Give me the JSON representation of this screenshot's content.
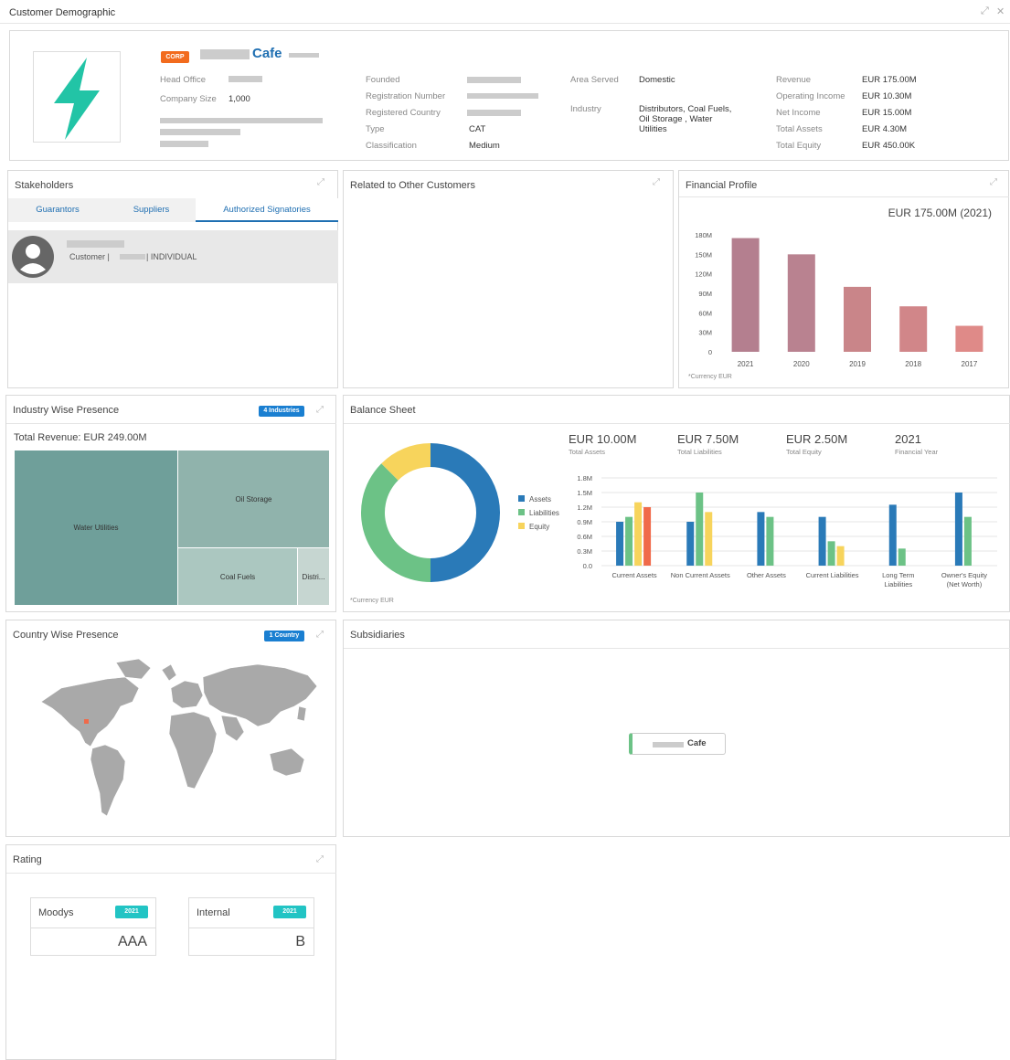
{
  "window": {
    "title": "Customer Demographic"
  },
  "profile": {
    "corp_badge": "CORP",
    "name_suffix": "Cafe",
    "head_office_label": "Head Office",
    "company_size_label": "Company Size",
    "company_size_value": "1,000",
    "founded_label": "Founded",
    "registration_label": "Registration Number",
    "registered_country_label": "Registered Country",
    "type_label": "Type",
    "type_value": "CAT",
    "classification_label": "Classification",
    "classification_value": "Medium",
    "area_served_label": "Area Served",
    "area_served_value": "Domestic",
    "industry_label": "Industry",
    "industry_value": "Distributors, Coal Fuels, Oil Storage , Water Utilities",
    "revenue_label": "Revenue",
    "revenue_value": "EUR 175.00M",
    "operating_income_label": "Operating Income",
    "operating_income_value": "EUR 10.30M",
    "net_income_label": "Net Income",
    "net_income_value": "EUR 15.00M",
    "total_assets_label": "Total Assets",
    "total_assets_value": "EUR 4.30M",
    "total_equity_label": "Total Equity",
    "total_equity_value": "EUR 450.00K",
    "logo_color": "#22c4a6"
  },
  "stakeholders": {
    "title": "Stakeholders",
    "tabs": [
      "Guarantors",
      "Suppliers",
      "Authorized Signatories"
    ],
    "active_tab": 2,
    "item": {
      "role_prefix": "Customer |",
      "role_suffix": "| INDIVIDUAL"
    }
  },
  "related": {
    "title": "Related to Other Customers"
  },
  "financial": {
    "title": "Financial Profile",
    "headline": "EUR 175.00M (2021)",
    "footnote": "*Currency EUR"
  },
  "industry": {
    "title": "Industry Wise Presence",
    "badge": "4 Industries",
    "total": "Total Revenue: EUR 249.00M",
    "tiles": [
      "Water Utilities",
      "Oil Storage",
      "Coal Fuels",
      "Distri..."
    ]
  },
  "balance": {
    "title": "Balance Sheet",
    "kpis": [
      {
        "value": "EUR 10.00M",
        "label": "Total Assets"
      },
      {
        "value": "EUR 7.50M",
        "label": "Total Liabilities"
      },
      {
        "value": "EUR 2.50M",
        "label": "Total Equity"
      },
      {
        "value": "2021",
        "label": "Financial Year"
      }
    ],
    "footnote": "*Currency EUR"
  },
  "country": {
    "title": "Country Wise Presence",
    "badge": "1 Country"
  },
  "subsidiaries": {
    "title": "Subsidiaries",
    "node_label": "Cafe"
  },
  "rating": {
    "title": "Rating",
    "cards": [
      {
        "agency": "Moodys",
        "year": "2021",
        "grade": "AAA"
      },
      {
        "agency": "Internal",
        "year": "2021",
        "grade": "B"
      }
    ]
  },
  "colors": {
    "accent": "#1f6fb2",
    "badge_blue": "#1a7fd1",
    "badge_teal": "#22c4c4",
    "corp_orange": "#f26b1d"
  },
  "chart_data": [
    {
      "type": "bar",
      "categories": [
        "2021",
        "2020",
        "2019",
        "2018",
        "2017"
      ],
      "values": [
        175,
        150,
        100,
        70,
        40
      ],
      "ylim": [
        0,
        180
      ],
      "yticks": [
        "0",
        "30M",
        "60M",
        "90M",
        "120M",
        "150M",
        "180M"
      ],
      "colors": [
        "#b47f8f",
        "#b98290",
        "#c98589",
        "#d18689",
        "#df8a88"
      ]
    },
    {
      "type": "pie",
      "labels": [
        "Assets",
        "Liabilities",
        "Equity"
      ],
      "values": [
        10.0,
        7.5,
        2.5
      ],
      "colors": [
        "#2a7ab8",
        "#6cc286",
        "#f7d45c"
      ],
      "legend": "right"
    },
    {
      "type": "bar",
      "categories": [
        "Current Assets",
        "Non Current Assets",
        "Other Assets",
        "Current Liabilities",
        "Long Term Liabilities",
        "Owner's Equity (Net Worth)"
      ],
      "category_lines": [
        [
          "Current Assets"
        ],
        [
          "Non Current Assets"
        ],
        [
          "Other Assets"
        ],
        [
          "Current Liabilities"
        ],
        [
          "Long Term",
          "Liabilities"
        ],
        [
          "Owner's Equity",
          "(Net Worth)"
        ]
      ],
      "series": [
        {
          "color": "#2a7ab8",
          "values": [
            0.9,
            0.9,
            1.1,
            1.0,
            1.25,
            1.5
          ]
        },
        {
          "color": "#6cc286",
          "values": [
            1.0,
            1.5,
            1.0,
            0.5,
            0.35,
            1.0
          ]
        },
        {
          "color": "#f7d45c",
          "values": [
            1.3,
            1.1,
            null,
            0.4,
            null,
            null
          ]
        },
        {
          "color": "#f06a4a",
          "values": [
            1.2,
            null,
            null,
            null,
            null,
            null
          ]
        }
      ],
      "ylim": [
        0,
        1.8
      ],
      "yticks": [
        "0.0",
        "0.3M",
        "0.6M",
        "0.9M",
        "1.2M",
        "1.5M",
        "1.8M"
      ]
    }
  ]
}
